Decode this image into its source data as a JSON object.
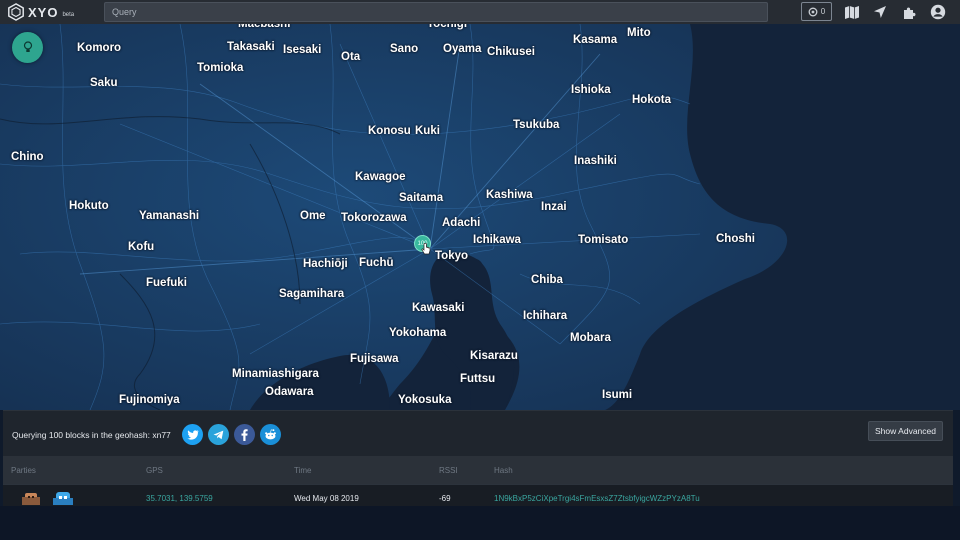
{
  "topbar": {
    "logo_text": "XYO",
    "logo_badge": "beta",
    "search_placeholder": "Query",
    "block_count": "0",
    "icons": [
      "block-icon",
      "map-icon",
      "location-arrow-icon",
      "puzzle-icon",
      "user-icon"
    ]
  },
  "map": {
    "places": [
      {
        "name": "Maebashi"
      },
      {
        "name": "Tochigi"
      },
      {
        "name": "Mito"
      },
      {
        "name": "Komoro"
      },
      {
        "name": "Takasaki"
      },
      {
        "name": "Isesaki"
      },
      {
        "name": "Sano"
      },
      {
        "name": "Oyama"
      },
      {
        "name": "Chikusei"
      },
      {
        "name": "Kasama"
      },
      {
        "name": "Ota"
      },
      {
        "name": "Saku"
      },
      {
        "name": "Tomioka"
      },
      {
        "name": "Ishioka"
      },
      {
        "name": "Hokota"
      },
      {
        "name": "Konosu"
      },
      {
        "name": "Kuki"
      },
      {
        "name": "Tsukuba"
      },
      {
        "name": "Chino"
      },
      {
        "name": "Inashiki"
      },
      {
        "name": "Kawagoe"
      },
      {
        "name": "Saitama"
      },
      {
        "name": "Kashiwa"
      },
      {
        "name": "Inzai"
      },
      {
        "name": "Hokuto"
      },
      {
        "name": "Yamanashi"
      },
      {
        "name": "Ome"
      },
      {
        "name": "Tokorozawa"
      },
      {
        "name": "Adachi"
      },
      {
        "name": "Kofu"
      },
      {
        "name": "Ichikawa"
      },
      {
        "name": "Tomisato"
      },
      {
        "name": "Choshi"
      },
      {
        "name": "Tokyo"
      },
      {
        "name": "Hachiōji"
      },
      {
        "name": "Fuchū"
      },
      {
        "name": "Fuefuki"
      },
      {
        "name": "Chiba"
      },
      {
        "name": "Sagamihara"
      },
      {
        "name": "Kawasaki"
      },
      {
        "name": "Ichihara"
      },
      {
        "name": "Yokohama"
      },
      {
        "name": "Mobara"
      },
      {
        "name": "Kisarazu"
      },
      {
        "name": "Fujisawa"
      },
      {
        "name": "Minamiashigara"
      },
      {
        "name": "Futtsu"
      },
      {
        "name": "Odawara"
      },
      {
        "name": "Fujinomiya"
      },
      {
        "name": "Yokosuka"
      },
      {
        "name": "Isumi"
      }
    ],
    "marker_count": "100"
  },
  "panel": {
    "query_text": "Querying 100 blocks in the geohash: xn77",
    "share_icons": [
      "twitter-icon",
      "telegram-icon",
      "facebook-icon",
      "reddit-icon"
    ],
    "advanced_label": "Show Advanced"
  },
  "table": {
    "headers": [
      "Parties",
      "GPS",
      "Time",
      "RSSI",
      "Hash"
    ],
    "rows": [
      {
        "gps": "35.7031, 139.5759",
        "time": "Wed May 08 2019",
        "rssi": "-69",
        "hash": "1N9kBxP5zCiXpeTrgi4sFmEsxsZ7ZtsbfyigcWZzPYzA8Tu"
      }
    ]
  },
  "colors": {
    "accent": "#2ea58f",
    "link": "#3aa7a0",
    "map_bg": "#10213a",
    "twitter": "#1da1f2",
    "telegram": "#2aa3db",
    "facebook": "#3b5998",
    "reddit": "#1a8fd8"
  }
}
